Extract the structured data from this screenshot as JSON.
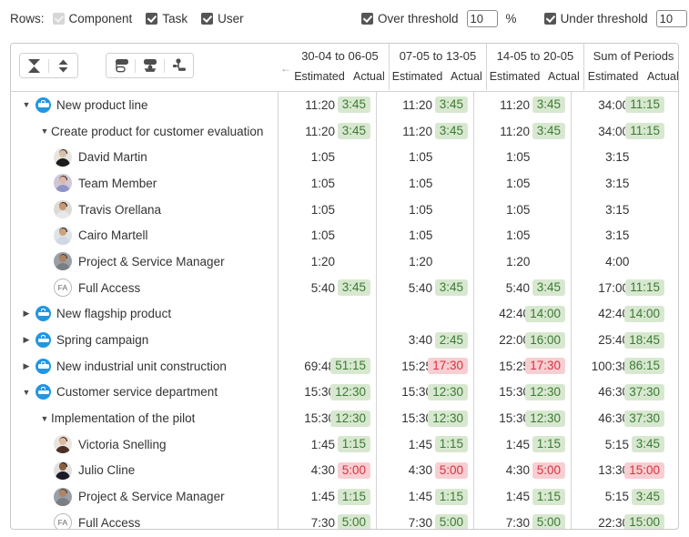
{
  "filters": {
    "rows_label": "Rows:",
    "row_types": [
      {
        "label": "Component",
        "checked": true,
        "disabled": true
      },
      {
        "label": "Task",
        "checked": true,
        "disabled": false
      },
      {
        "label": "User",
        "checked": true,
        "disabled": false
      }
    ],
    "over_threshold": {
      "label": "Over threshold",
      "checked": true,
      "value": "10",
      "unit": "%"
    },
    "under_threshold": {
      "label": "Under threshold",
      "checked": true,
      "value": "10",
      "unit": "%"
    }
  },
  "toolbar": {
    "buttons": [
      {
        "name": "collapse-all-icon",
        "title": "Collapse all"
      },
      {
        "name": "expand-collapse-level-icon",
        "title": "Expand level"
      },
      {
        "name": "group-by-component-icon",
        "title": "Group by component"
      },
      {
        "name": "group-by-task-icon",
        "title": "Group by task"
      },
      {
        "name": "group-by-user-icon",
        "title": "Group by user"
      }
    ]
  },
  "table": {
    "back_arrow": "←",
    "column_groups": [
      {
        "title": "30-04 to 06-05",
        "subs": [
          "Estimated",
          "Actual"
        ]
      },
      {
        "title": "07-05 to 13-05",
        "subs": [
          "Estimated",
          "Actual"
        ]
      },
      {
        "title": "14-05 to 20-05",
        "subs": [
          "Estimated",
          "Actual"
        ]
      },
      {
        "title": "Sum of Periods",
        "subs": [
          "Estimated",
          "Actual"
        ]
      }
    ],
    "rows": [
      {
        "name": "New product line",
        "type": "component",
        "level": 0,
        "twisty": "expanded",
        "cells": [
          {
            "est": "11:20",
            "act": "3:45",
            "act_state": "green"
          },
          {
            "est": "11:20",
            "act": "3:45",
            "act_state": "green"
          },
          {
            "est": "11:20",
            "act": "3:45",
            "act_state": "green"
          },
          {
            "est": "34:00",
            "act": "11:15",
            "act_state": "green"
          }
        ]
      },
      {
        "name": "Create product for customer evaluation",
        "type": "task",
        "level": 1,
        "twisty": "expanded",
        "cells": [
          {
            "est": "11:20",
            "act": "3:45",
            "act_state": "green"
          },
          {
            "est": "11:20",
            "act": "3:45",
            "act_state": "green"
          },
          {
            "est": "11:20",
            "act": "3:45",
            "act_state": "green"
          },
          {
            "est": "34:00",
            "act": "11:15",
            "act_state": "green"
          }
        ]
      },
      {
        "name": "David Martin",
        "type": "user",
        "level": 2,
        "avatar": {
          "style": "photo",
          "hair": "#2b2b2b",
          "skin": "#d8c0ab",
          "shirt": "#1d1d1d",
          "bg": "#e8e5e0"
        },
        "cells": [
          {
            "est": "1:05",
            "act": "",
            "act_state": "none"
          },
          {
            "est": "1:05",
            "act": "",
            "act_state": "none"
          },
          {
            "est": "1:05",
            "act": "",
            "act_state": "none"
          },
          {
            "est": "3:15",
            "act": "",
            "act_state": "none"
          }
        ]
      },
      {
        "name": "Team Member",
        "type": "user",
        "level": 2,
        "avatar": {
          "style": "photo",
          "hair": "#3a2b2b",
          "skin": "#dcb9a4",
          "shirt": "#8f94c4",
          "bg": "#cfc7d6"
        },
        "cells": [
          {
            "est": "1:05",
            "act": "",
            "act_state": "none"
          },
          {
            "est": "1:05",
            "act": "",
            "act_state": "none"
          },
          {
            "est": "1:05",
            "act": "",
            "act_state": "none"
          },
          {
            "est": "3:15",
            "act": "",
            "act_state": "none"
          }
        ]
      },
      {
        "name": "Travis Orellana",
        "type": "user",
        "level": 2,
        "avatar": {
          "style": "photo",
          "hair": "#2e2218",
          "skin": "#c89872",
          "shirt": "#e8e8ea",
          "bg": "#ddd9d4"
        },
        "cells": [
          {
            "est": "1:05",
            "act": "",
            "act_state": "none"
          },
          {
            "est": "1:05",
            "act": "",
            "act_state": "none"
          },
          {
            "est": "1:05",
            "act": "",
            "act_state": "none"
          },
          {
            "est": "3:15",
            "act": "",
            "act_state": "none"
          }
        ]
      },
      {
        "name": "Cairo Martell",
        "type": "user",
        "level": 2,
        "avatar": {
          "style": "photo",
          "hair": "#26211d",
          "skin": "#cfa27c",
          "shirt": "#cfd8e3",
          "bg": "#dfe3e8"
        },
        "cells": [
          {
            "est": "1:05",
            "act": "",
            "act_state": "none"
          },
          {
            "est": "1:05",
            "act": "",
            "act_state": "none"
          },
          {
            "est": "1:05",
            "act": "",
            "act_state": "none"
          },
          {
            "est": "3:15",
            "act": "",
            "act_state": "none"
          }
        ]
      },
      {
        "name": "Project & Service Manager",
        "type": "user",
        "level": 2,
        "avatar": {
          "style": "photo",
          "hair": "#4a3b30",
          "skin": "#b08463",
          "shirt": "#7a7f86",
          "bg": "#9aa0a6"
        },
        "cells": [
          {
            "est": "1:20",
            "act": "",
            "act_state": "none"
          },
          {
            "est": "1:20",
            "act": "",
            "act_state": "none"
          },
          {
            "est": "1:20",
            "act": "",
            "act_state": "none"
          },
          {
            "est": "4:00",
            "act": "",
            "act_state": "none"
          }
        ]
      },
      {
        "name": "Full Access",
        "type": "user",
        "level": 2,
        "avatar": {
          "style": "initials",
          "initials": "FA"
        },
        "cells": [
          {
            "est": "5:40",
            "act": "3:45",
            "act_state": "green"
          },
          {
            "est": "5:40",
            "act": "3:45",
            "act_state": "green"
          },
          {
            "est": "5:40",
            "act": "3:45",
            "act_state": "green"
          },
          {
            "est": "17:00",
            "act": "11:15",
            "act_state": "green"
          }
        ]
      },
      {
        "name": "New flagship product",
        "type": "component",
        "level": 0,
        "twisty": "collapsed",
        "cells": [
          {
            "est": "",
            "act": "",
            "act_state": "none"
          },
          {
            "est": "",
            "act": "",
            "act_state": "none"
          },
          {
            "est": "42:40",
            "act": "14:00",
            "act_state": "green"
          },
          {
            "est": "42:40",
            "act": "14:00",
            "act_state": "green"
          }
        ]
      },
      {
        "name": "Spring campaign",
        "type": "component",
        "level": 0,
        "twisty": "collapsed",
        "cells": [
          {
            "est": "",
            "act": "",
            "act_state": "none"
          },
          {
            "est": "3:40",
            "act": "2:45",
            "act_state": "green"
          },
          {
            "est": "22:00",
            "act": "16:00",
            "act_state": "green"
          },
          {
            "est": "25:40",
            "act": "18:45",
            "act_state": "green"
          }
        ]
      },
      {
        "name": "New industrial unit construction",
        "type": "component",
        "level": 0,
        "twisty": "collapsed",
        "cells": [
          {
            "est": "69:48",
            "act": "51:15",
            "act_state": "green"
          },
          {
            "est": "15:25",
            "act": "17:30",
            "act_state": "red"
          },
          {
            "est": "15:25",
            "act": "17:30",
            "act_state": "red"
          },
          {
            "est": "100:38",
            "act": "86:15",
            "act_state": "green"
          }
        ]
      },
      {
        "name": "Customer service department",
        "type": "component",
        "level": 0,
        "twisty": "expanded",
        "cells": [
          {
            "est": "15:30",
            "act": "12:30",
            "act_state": "green"
          },
          {
            "est": "15:30",
            "act": "12:30",
            "act_state": "green"
          },
          {
            "est": "15:30",
            "act": "12:30",
            "act_state": "green"
          },
          {
            "est": "46:30",
            "act": "37:30",
            "act_state": "green"
          }
        ]
      },
      {
        "name": "Implementation of the pilot",
        "type": "task",
        "level": 1,
        "twisty": "expanded",
        "cells": [
          {
            "est": "15:30",
            "act": "12:30",
            "act_state": "green"
          },
          {
            "est": "15:30",
            "act": "12:30",
            "act_state": "green"
          },
          {
            "est": "15:30",
            "act": "12:30",
            "act_state": "green"
          },
          {
            "est": "46:30",
            "act": "37:30",
            "act_state": "green"
          }
        ]
      },
      {
        "name": "Victoria Snelling",
        "type": "user",
        "level": 2,
        "avatar": {
          "style": "photo",
          "hair": "#3a2018",
          "skin": "#e0bba0",
          "shirt": "#4b3026",
          "bg": "#e9e4de"
        },
        "cells": [
          {
            "est": "1:45",
            "act": "1:15",
            "act_state": "green"
          },
          {
            "est": "1:45",
            "act": "1:15",
            "act_state": "green"
          },
          {
            "est": "1:45",
            "act": "1:15",
            "act_state": "green"
          },
          {
            "est": "5:15",
            "act": "3:45",
            "act_state": "green"
          }
        ]
      },
      {
        "name": "Julio Cline",
        "type": "user",
        "level": 2,
        "avatar": {
          "style": "photo",
          "hair": "#171717",
          "skin": "#8a5d3f",
          "shirt": "#1b1b26",
          "bg": "#e2e0dd"
        },
        "cells": [
          {
            "est": "4:30",
            "act": "5:00",
            "act_state": "red"
          },
          {
            "est": "4:30",
            "act": "5:00",
            "act_state": "red"
          },
          {
            "est": "4:30",
            "act": "5:00",
            "act_state": "red"
          },
          {
            "est": "13:30",
            "act": "15:00",
            "act_state": "red"
          }
        ]
      },
      {
        "name": "Project & Service Manager",
        "type": "user",
        "level": 2,
        "avatar": {
          "style": "photo",
          "hair": "#4a3b30",
          "skin": "#b08463",
          "shirt": "#7a7f86",
          "bg": "#9aa0a6"
        },
        "cells": [
          {
            "est": "1:45",
            "act": "1:15",
            "act_state": "green"
          },
          {
            "est": "1:45",
            "act": "1:15",
            "act_state": "green"
          },
          {
            "est": "1:45",
            "act": "1:15",
            "act_state": "green"
          },
          {
            "est": "5:15",
            "act": "3:45",
            "act_state": "green"
          }
        ]
      },
      {
        "name": "Full Access",
        "type": "user",
        "level": 2,
        "avatar": {
          "style": "initials",
          "initials": "FA"
        },
        "cells": [
          {
            "est": "7:30",
            "act": "5:00",
            "act_state": "green"
          },
          {
            "est": "7:30",
            "act": "5:00",
            "act_state": "green"
          },
          {
            "est": "7:30",
            "act": "5:00",
            "act_state": "green"
          },
          {
            "est": "22:30",
            "act": "15:00",
            "act_state": "green"
          }
        ]
      }
    ]
  },
  "colors": {
    "green_bg": "#d8e8d0",
    "green_text": "#3b7a34",
    "red_bg": "#f7ced1",
    "red_text": "#d9323f",
    "project_blue": "#2196e3"
  }
}
